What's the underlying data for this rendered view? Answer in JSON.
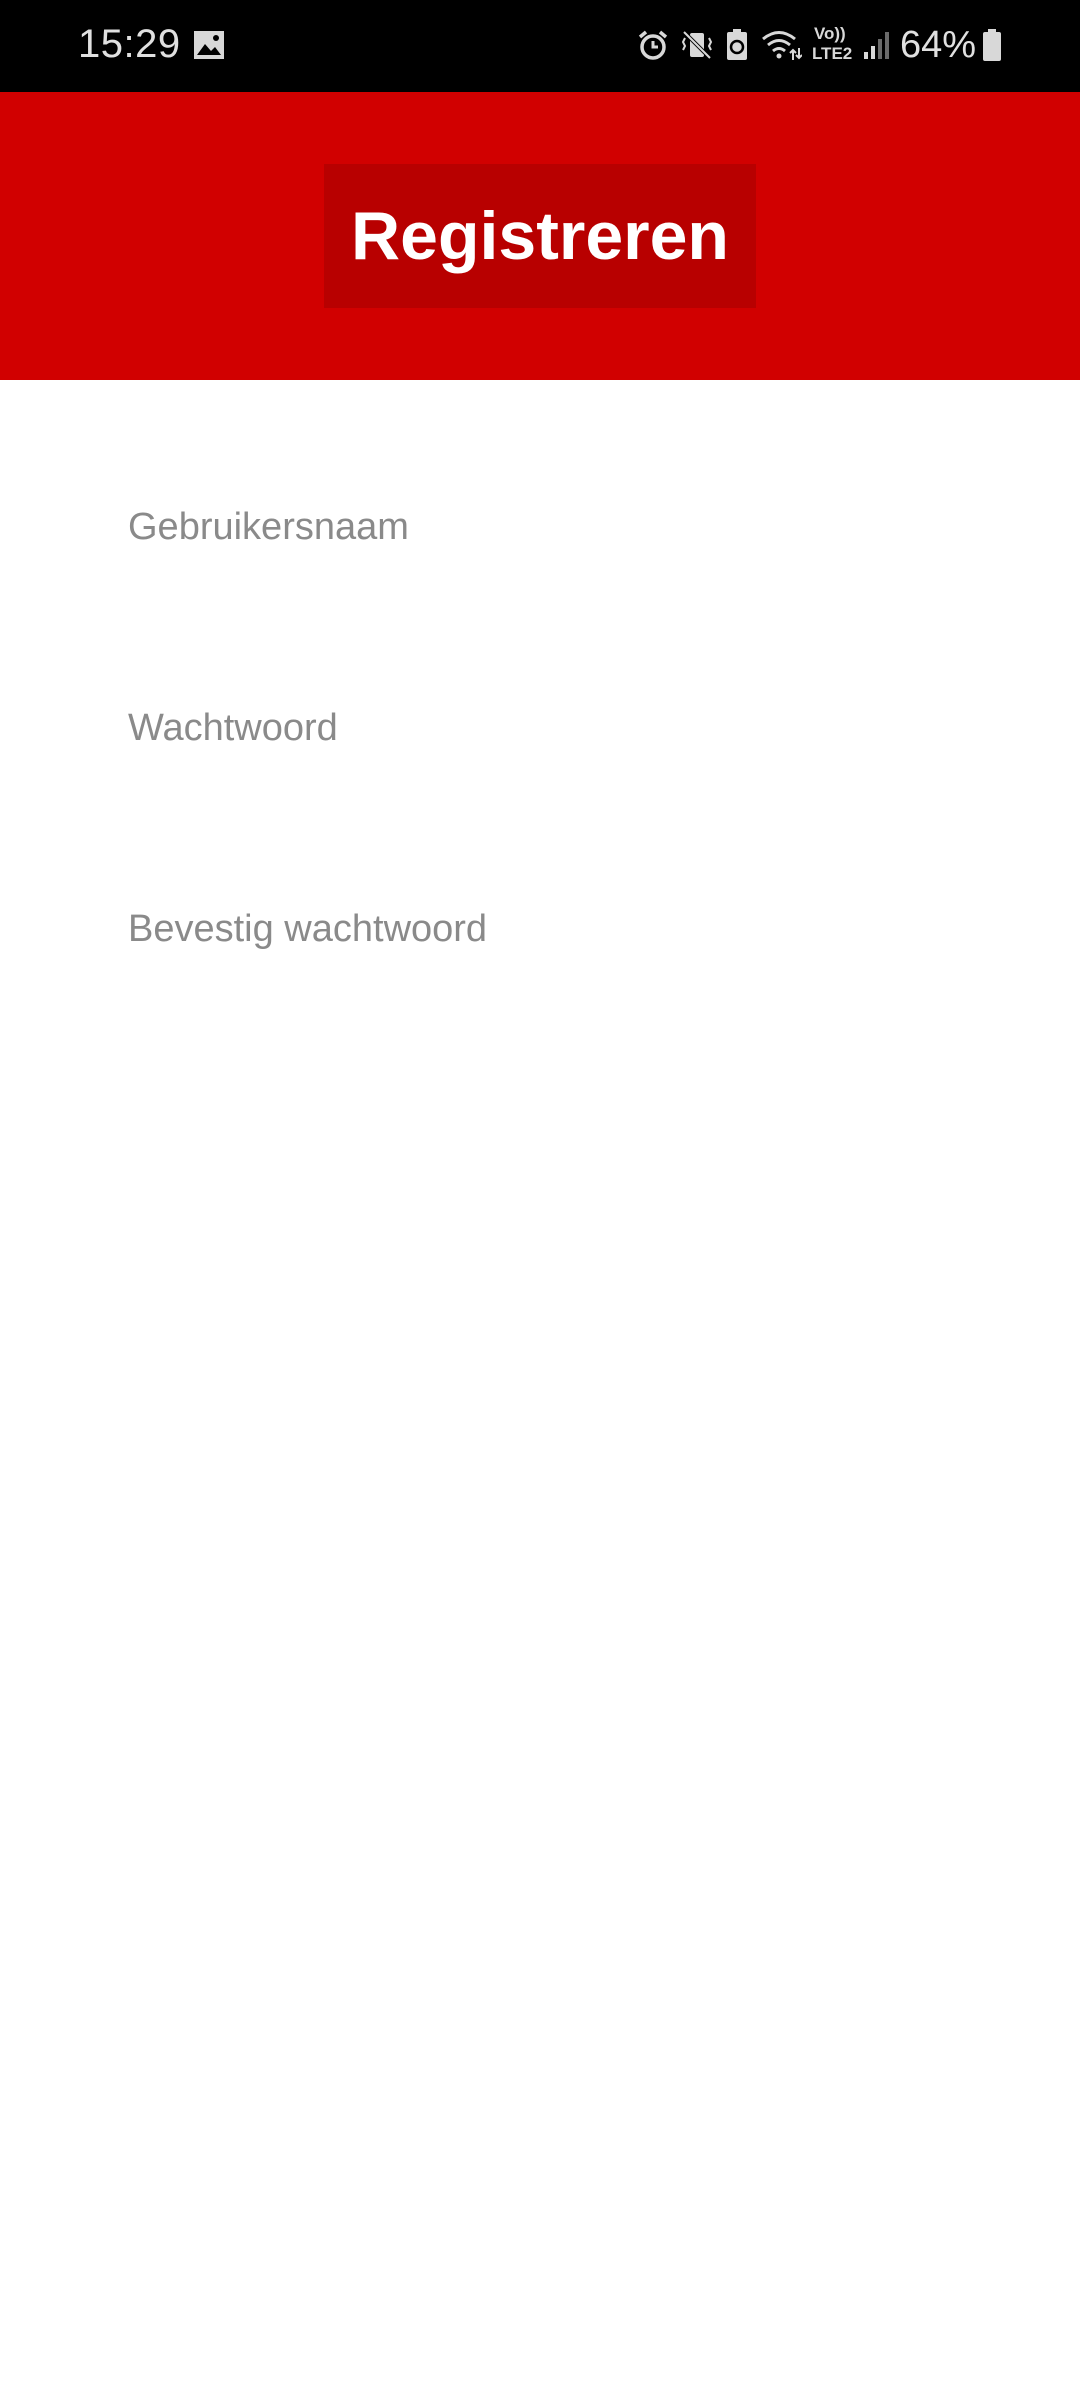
{
  "status_bar": {
    "time": "15:29",
    "battery_percent": "64%",
    "network_label_top": "Vo))",
    "network_label_bottom": "LTE2",
    "icons": [
      "gallery-icon",
      "alarm-icon",
      "vibrate-off-icon",
      "battery-saver-icon",
      "wifi-icon",
      "volte-icon",
      "signal-icon",
      "battery-icon"
    ]
  },
  "header": {
    "title": "Registreren",
    "background_color": "#d10000",
    "button_color": "#b80000"
  },
  "form": {
    "username_placeholder": "Gebruikersnaam",
    "password_placeholder": "Wachtwoord",
    "confirm_password_placeholder": "Bevestig wachtwoord"
  }
}
